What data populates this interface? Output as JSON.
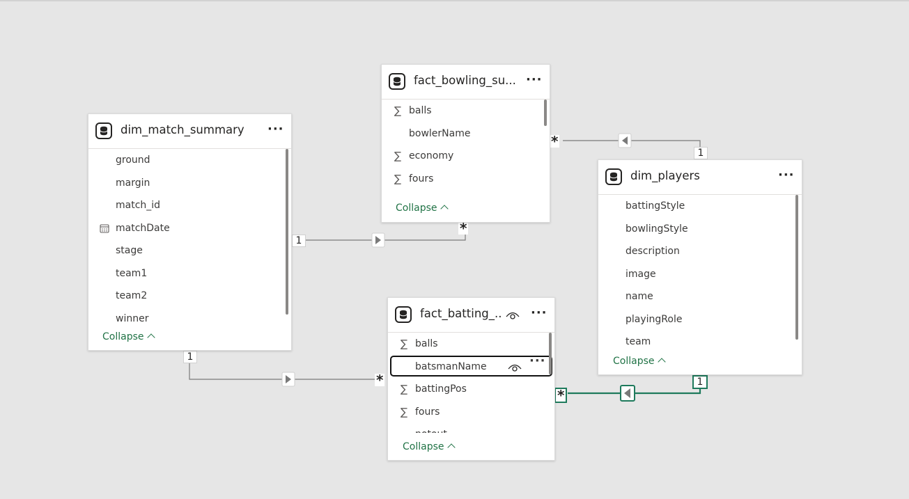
{
  "tables": {
    "bowling": {
      "title": "fact_bowling_su...",
      "fields": [
        {
          "name": "balls",
          "icon": "sigma-icon",
          "glyph": "∑"
        },
        {
          "name": "bowlerName",
          "icon": "",
          "glyph": ""
        },
        {
          "name": "economy",
          "icon": "sigma-icon",
          "glyph": "∑"
        },
        {
          "name": "fours",
          "icon": "sigma-icon",
          "glyph": "∑"
        }
      ],
      "collapse_label": "Collapse",
      "more_label": "···"
    },
    "match": {
      "title": "dim_match_summary",
      "fields": [
        {
          "name": "ground",
          "icon": "",
          "glyph": ""
        },
        {
          "name": "margin",
          "icon": "",
          "glyph": ""
        },
        {
          "name": "match_id",
          "icon": "",
          "glyph": ""
        },
        {
          "name": "matchDate",
          "icon": "calendar-icon",
          "glyph": "▦"
        },
        {
          "name": "stage",
          "icon": "",
          "glyph": ""
        },
        {
          "name": "team1",
          "icon": "",
          "glyph": ""
        },
        {
          "name": "team2",
          "icon": "",
          "glyph": ""
        },
        {
          "name": "winner",
          "icon": "",
          "glyph": ""
        }
      ],
      "collapse_label": "Collapse",
      "more_label": "···"
    },
    "players": {
      "title": "dim_players",
      "fields": [
        {
          "name": "battingStyle",
          "icon": "",
          "glyph": ""
        },
        {
          "name": "bowlingStyle",
          "icon": "",
          "glyph": ""
        },
        {
          "name": "description",
          "icon": "",
          "glyph": ""
        },
        {
          "name": "image",
          "icon": "",
          "glyph": ""
        },
        {
          "name": "name",
          "icon": "",
          "glyph": ""
        },
        {
          "name": "playingRole",
          "icon": "",
          "glyph": ""
        },
        {
          "name": "team",
          "icon": "",
          "glyph": ""
        }
      ],
      "collapse_label": "Collapse",
      "more_label": "···"
    },
    "batting": {
      "title": "fact_batting_...",
      "fields": [
        {
          "name": "balls",
          "icon": "sigma-icon",
          "glyph": "∑"
        },
        {
          "name": "batsmanName",
          "icon": "",
          "glyph": ""
        },
        {
          "name": "battingPos",
          "icon": "sigma-icon",
          "glyph": "∑"
        },
        {
          "name": "fours",
          "icon": "sigma-icon",
          "glyph": "∑"
        },
        {
          "name": "notout",
          "icon": "",
          "glyph": ""
        }
      ],
      "selected_field": "batsmanName",
      "collapse_label": "Collapse",
      "more_label": "···"
    }
  },
  "relationships": [
    {
      "from": "dim_match_summary",
      "to": "fact_bowling_su...",
      "from_card": "1",
      "to_card": "*"
    },
    {
      "from": "dim_players",
      "to": "fact_bowling_su...",
      "from_card": "1",
      "to_card": "*"
    },
    {
      "from": "dim_match_summary",
      "to": "fact_batting_...",
      "from_card": "1",
      "to_card": "*"
    },
    {
      "from": "dim_players",
      "to": "fact_batting_...",
      "from_card": "1",
      "to_card": "*",
      "highlighted": true
    }
  ],
  "colors": {
    "accent": "#217346",
    "highlight_line": "#1e7a5c",
    "line": "#7a7a7a",
    "canvas": "#e6e6e6"
  }
}
